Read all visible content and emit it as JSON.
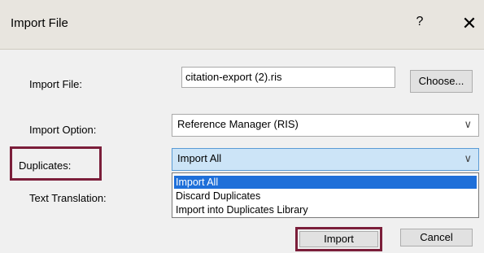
{
  "window": {
    "title": "Import File",
    "help_glyph": "?",
    "close_glyph": "✕"
  },
  "form": {
    "import_file_label": "Import File:",
    "import_file_value": "citation-export (2).ris",
    "choose_label": "Choose...",
    "import_option_label": "Import Option:",
    "import_option_value": "Reference Manager (RIS)",
    "duplicates_label": "Duplicates:",
    "duplicates_value": "Import All",
    "duplicates_options": [
      "Import All",
      "Discard Duplicates",
      "Import into Duplicates Library"
    ],
    "text_translation_label": "Text Translation:"
  },
  "buttons": {
    "import_label": "Import",
    "cancel_label": "Cancel"
  },
  "icons": {
    "dropdown": "chevron-down-icon",
    "close": "close-icon",
    "help": "help-icon"
  },
  "colors": {
    "highlight": "#7b1e3a",
    "selection": "#1e6fd9",
    "focused_select": "#cce4f7"
  }
}
